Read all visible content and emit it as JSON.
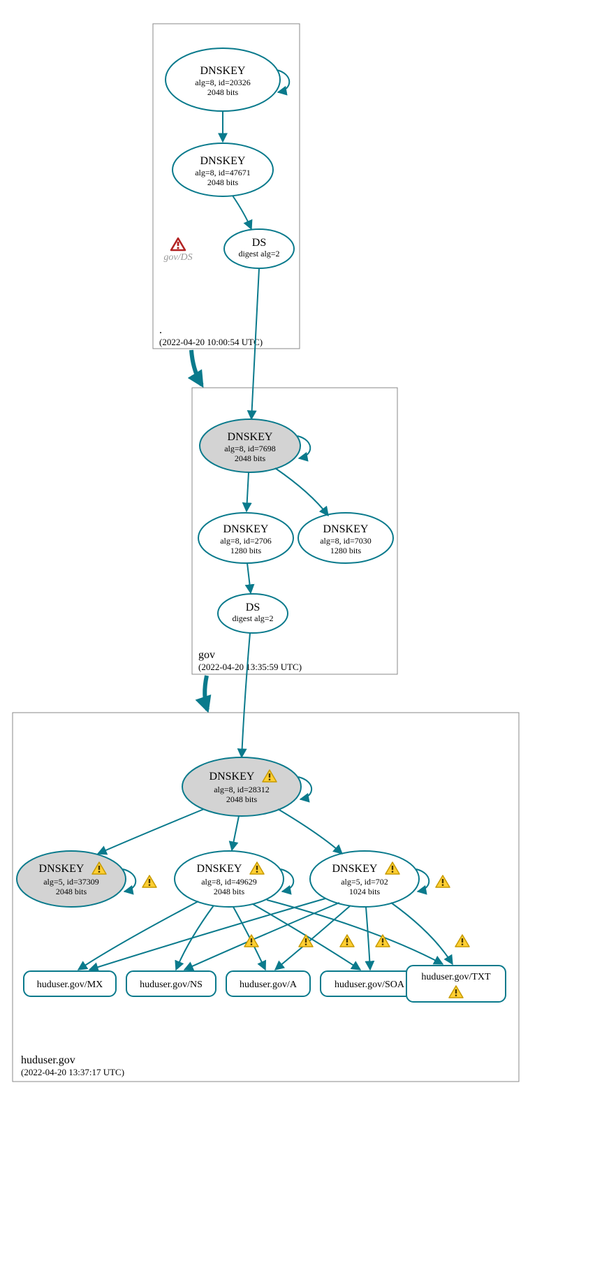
{
  "colors": {
    "stroke": "#0a7a8c",
    "fill_grey": "#d3d3d3"
  },
  "zones": {
    "root": {
      "name": ".",
      "timestamp": "(2022-04-20 10:00:54 UTC)"
    },
    "gov": {
      "name": "gov",
      "timestamp": "(2022-04-20 13:35:59 UTC)"
    },
    "huduser": {
      "name": "huduser.gov",
      "timestamp": "(2022-04-20 13:37:17 UTC)"
    }
  },
  "nodes": {
    "root_ksk": {
      "title": "DNSKEY",
      "line1": "alg=8, id=20326",
      "line2": "2048 bits"
    },
    "root_zsk": {
      "title": "DNSKEY",
      "line1": "alg=8, id=47671",
      "line2": "2048 bits"
    },
    "root_ds": {
      "title": "DS",
      "line1": "digest alg=2",
      "line2": ""
    },
    "gov_ds_warn": {
      "label": "gov/DS"
    },
    "gov_ksk": {
      "title": "DNSKEY",
      "line1": "alg=8, id=7698",
      "line2": "2048 bits"
    },
    "gov_zsk1": {
      "title": "DNSKEY",
      "line1": "alg=8, id=2706",
      "line2": "1280 bits"
    },
    "gov_zsk2": {
      "title": "DNSKEY",
      "line1": "alg=8, id=7030",
      "line2": "1280 bits"
    },
    "gov_ds": {
      "title": "DS",
      "line1": "digest alg=2",
      "line2": ""
    },
    "hud_ksk": {
      "title": "DNSKEY",
      "line1": "alg=8, id=28312",
      "line2": "2048 bits"
    },
    "hud_k1": {
      "title": "DNSKEY",
      "line1": "alg=5, id=37309",
      "line2": "2048 bits"
    },
    "hud_k2": {
      "title": "DNSKEY",
      "line1": "alg=8, id=49629",
      "line2": "2048 bits"
    },
    "hud_k3": {
      "title": "DNSKEY",
      "line1": "alg=5, id=702",
      "line2": "1024 bits"
    },
    "rr_mx": {
      "label": "huduser.gov/MX"
    },
    "rr_ns": {
      "label": "huduser.gov/NS"
    },
    "rr_a": {
      "label": "huduser.gov/A"
    },
    "rr_soa": {
      "label": "huduser.gov/SOA"
    },
    "rr_txt": {
      "label": "huduser.gov/TXT"
    }
  }
}
